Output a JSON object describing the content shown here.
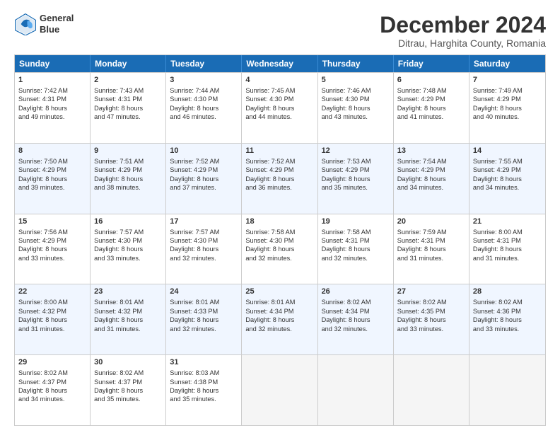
{
  "logo": {
    "line1": "General",
    "line2": "Blue"
  },
  "title": "December 2024",
  "subtitle": "Ditrau, Harghita County, Romania",
  "days": [
    "Sunday",
    "Monday",
    "Tuesday",
    "Wednesday",
    "Thursday",
    "Friday",
    "Saturday"
  ],
  "rows": [
    [
      {
        "num": "1",
        "lines": [
          "Sunrise: 7:42 AM",
          "Sunset: 4:31 PM",
          "Daylight: 8 hours",
          "and 49 minutes."
        ]
      },
      {
        "num": "2",
        "lines": [
          "Sunrise: 7:43 AM",
          "Sunset: 4:31 PM",
          "Daylight: 8 hours",
          "and 47 minutes."
        ]
      },
      {
        "num": "3",
        "lines": [
          "Sunrise: 7:44 AM",
          "Sunset: 4:30 PM",
          "Daylight: 8 hours",
          "and 46 minutes."
        ]
      },
      {
        "num": "4",
        "lines": [
          "Sunrise: 7:45 AM",
          "Sunset: 4:30 PM",
          "Daylight: 8 hours",
          "and 44 minutes."
        ]
      },
      {
        "num": "5",
        "lines": [
          "Sunrise: 7:46 AM",
          "Sunset: 4:30 PM",
          "Daylight: 8 hours",
          "and 43 minutes."
        ]
      },
      {
        "num": "6",
        "lines": [
          "Sunrise: 7:48 AM",
          "Sunset: 4:29 PM",
          "Daylight: 8 hours",
          "and 41 minutes."
        ]
      },
      {
        "num": "7",
        "lines": [
          "Sunrise: 7:49 AM",
          "Sunset: 4:29 PM",
          "Daylight: 8 hours",
          "and 40 minutes."
        ]
      }
    ],
    [
      {
        "num": "8",
        "lines": [
          "Sunrise: 7:50 AM",
          "Sunset: 4:29 PM",
          "Daylight: 8 hours",
          "and 39 minutes."
        ]
      },
      {
        "num": "9",
        "lines": [
          "Sunrise: 7:51 AM",
          "Sunset: 4:29 PM",
          "Daylight: 8 hours",
          "and 38 minutes."
        ]
      },
      {
        "num": "10",
        "lines": [
          "Sunrise: 7:52 AM",
          "Sunset: 4:29 PM",
          "Daylight: 8 hours",
          "and 37 minutes."
        ]
      },
      {
        "num": "11",
        "lines": [
          "Sunrise: 7:52 AM",
          "Sunset: 4:29 PM",
          "Daylight: 8 hours",
          "and 36 minutes."
        ]
      },
      {
        "num": "12",
        "lines": [
          "Sunrise: 7:53 AM",
          "Sunset: 4:29 PM",
          "Daylight: 8 hours",
          "and 35 minutes."
        ]
      },
      {
        "num": "13",
        "lines": [
          "Sunrise: 7:54 AM",
          "Sunset: 4:29 PM",
          "Daylight: 8 hours",
          "and 34 minutes."
        ]
      },
      {
        "num": "14",
        "lines": [
          "Sunrise: 7:55 AM",
          "Sunset: 4:29 PM",
          "Daylight: 8 hours",
          "and 34 minutes."
        ]
      }
    ],
    [
      {
        "num": "15",
        "lines": [
          "Sunrise: 7:56 AM",
          "Sunset: 4:29 PM",
          "Daylight: 8 hours",
          "and 33 minutes."
        ]
      },
      {
        "num": "16",
        "lines": [
          "Sunrise: 7:57 AM",
          "Sunset: 4:30 PM",
          "Daylight: 8 hours",
          "and 33 minutes."
        ]
      },
      {
        "num": "17",
        "lines": [
          "Sunrise: 7:57 AM",
          "Sunset: 4:30 PM",
          "Daylight: 8 hours",
          "and 32 minutes."
        ]
      },
      {
        "num": "18",
        "lines": [
          "Sunrise: 7:58 AM",
          "Sunset: 4:30 PM",
          "Daylight: 8 hours",
          "and 32 minutes."
        ]
      },
      {
        "num": "19",
        "lines": [
          "Sunrise: 7:58 AM",
          "Sunset: 4:31 PM",
          "Daylight: 8 hours",
          "and 32 minutes."
        ]
      },
      {
        "num": "20",
        "lines": [
          "Sunrise: 7:59 AM",
          "Sunset: 4:31 PM",
          "Daylight: 8 hours",
          "and 31 minutes."
        ]
      },
      {
        "num": "21",
        "lines": [
          "Sunrise: 8:00 AM",
          "Sunset: 4:31 PM",
          "Daylight: 8 hours",
          "and 31 minutes."
        ]
      }
    ],
    [
      {
        "num": "22",
        "lines": [
          "Sunrise: 8:00 AM",
          "Sunset: 4:32 PM",
          "Daylight: 8 hours",
          "and 31 minutes."
        ]
      },
      {
        "num": "23",
        "lines": [
          "Sunrise: 8:01 AM",
          "Sunset: 4:32 PM",
          "Daylight: 8 hours",
          "and 31 minutes."
        ]
      },
      {
        "num": "24",
        "lines": [
          "Sunrise: 8:01 AM",
          "Sunset: 4:33 PM",
          "Daylight: 8 hours",
          "and 32 minutes."
        ]
      },
      {
        "num": "25",
        "lines": [
          "Sunrise: 8:01 AM",
          "Sunset: 4:34 PM",
          "Daylight: 8 hours",
          "and 32 minutes."
        ]
      },
      {
        "num": "26",
        "lines": [
          "Sunrise: 8:02 AM",
          "Sunset: 4:34 PM",
          "Daylight: 8 hours",
          "and 32 minutes."
        ]
      },
      {
        "num": "27",
        "lines": [
          "Sunrise: 8:02 AM",
          "Sunset: 4:35 PM",
          "Daylight: 8 hours",
          "and 33 minutes."
        ]
      },
      {
        "num": "28",
        "lines": [
          "Sunrise: 8:02 AM",
          "Sunset: 4:36 PM",
          "Daylight: 8 hours",
          "and 33 minutes."
        ]
      }
    ],
    [
      {
        "num": "29",
        "lines": [
          "Sunrise: 8:02 AM",
          "Sunset: 4:37 PM",
          "Daylight: 8 hours",
          "and 34 minutes."
        ]
      },
      {
        "num": "30",
        "lines": [
          "Sunrise: 8:02 AM",
          "Sunset: 4:37 PM",
          "Daylight: 8 hours",
          "and 35 minutes."
        ]
      },
      {
        "num": "31",
        "lines": [
          "Sunrise: 8:03 AM",
          "Sunset: 4:38 PM",
          "Daylight: 8 hours",
          "and 35 minutes."
        ]
      },
      {
        "num": "",
        "lines": []
      },
      {
        "num": "",
        "lines": []
      },
      {
        "num": "",
        "lines": []
      },
      {
        "num": "",
        "lines": []
      }
    ]
  ]
}
